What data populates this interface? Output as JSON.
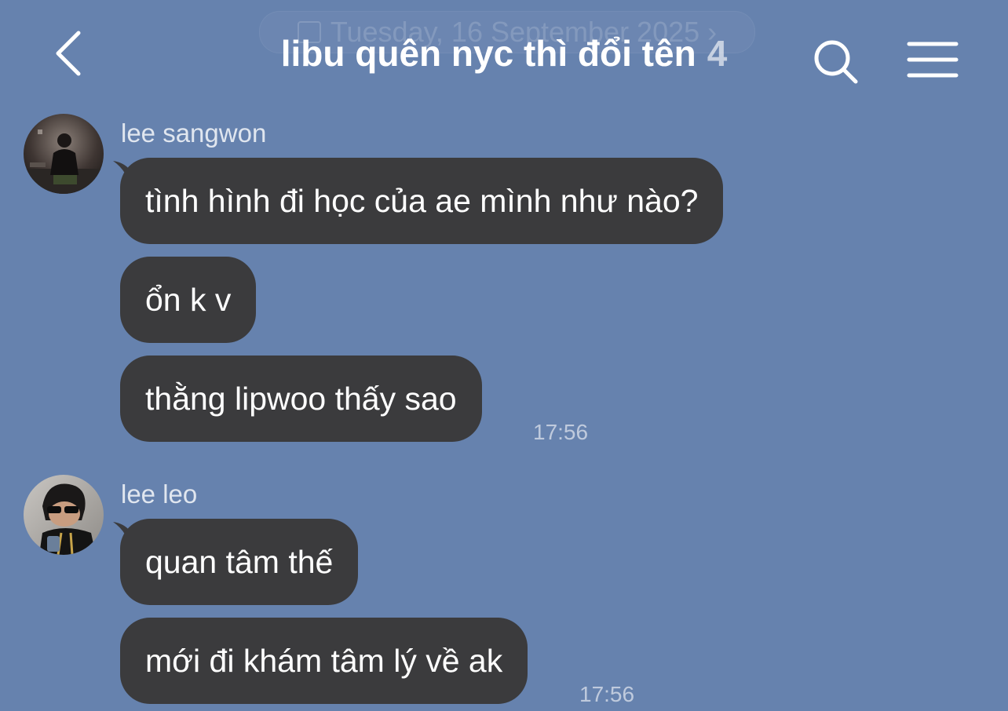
{
  "header": {
    "title": "libu quên nyc thì đổi tên",
    "member_count": "4",
    "date_banner": "Tuesday, 16 September 2025",
    "back_icon": "chevron-left-icon",
    "search_icon": "search-icon",
    "menu_icon": "hamburger-menu-icon"
  },
  "colors": {
    "background": "#6682ae",
    "bubble": "#3b3b3d",
    "text": "#ffffff"
  },
  "messages": [
    {
      "sender": "lee sangwon",
      "bubbles": [
        "tình hình đi học của ae mình như nào?",
        "ổn k v",
        "thằng lipwoo thấy sao"
      ],
      "time": "17:56"
    },
    {
      "sender": "lee leo",
      "bubbles": [
        "quan tâm thế",
        "mới đi khám tâm lý về ak"
      ],
      "time": "17:56"
    }
  ]
}
